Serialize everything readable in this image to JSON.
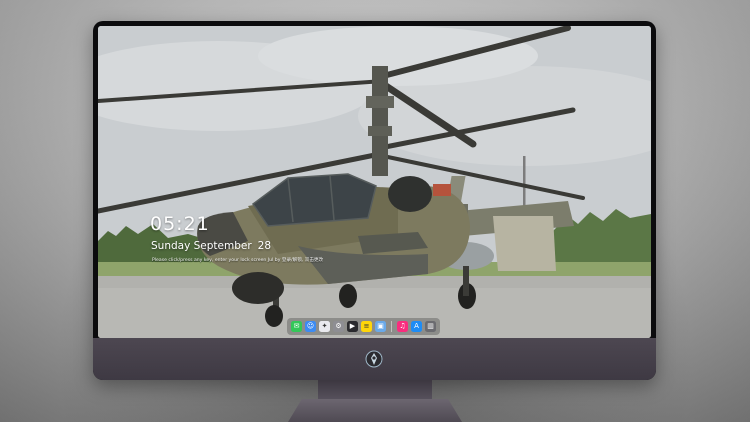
{
  "lockscreen": {
    "time": "05:21",
    "weekday_month": "Sunday September",
    "day": "28",
    "note": "Please click/press any key, enter your lock screen Jul by 登录/解锁, 双击更改"
  },
  "dock": {
    "apps": [
      {
        "name": "messages-icon",
        "glyph": "✉",
        "color": "#34c759"
      },
      {
        "name": "finder-icon",
        "glyph": "☺",
        "color": "#3d8bf2"
      },
      {
        "name": "safari-icon",
        "glyph": "✦",
        "color": "#e9e9ee"
      },
      {
        "name": "system-settings-icon",
        "glyph": "⚙",
        "color": "#8e8e93"
      },
      {
        "name": "final-cut-icon",
        "glyph": "▶",
        "color": "#2a2a2e"
      },
      {
        "name": "notes-icon",
        "glyph": "≡",
        "color": "#ffd60a"
      },
      {
        "name": "preview-icon",
        "glyph": "▣",
        "color": "#6aa9e8"
      },
      {
        "name": "music-icon",
        "glyph": "♫",
        "color": "#fa2d7e"
      },
      {
        "name": "app-store-icon",
        "glyph": "A",
        "color": "#1e8cf5"
      },
      {
        "name": "trash-icon",
        "glyph": "▥",
        "color": "#6b6b70"
      }
    ]
  },
  "colors": {
    "bezel": "#0b0b0d",
    "chin": "#4d4751",
    "helicopter_camo": "#7d7a5f",
    "sky": "#cfd3d6"
  }
}
